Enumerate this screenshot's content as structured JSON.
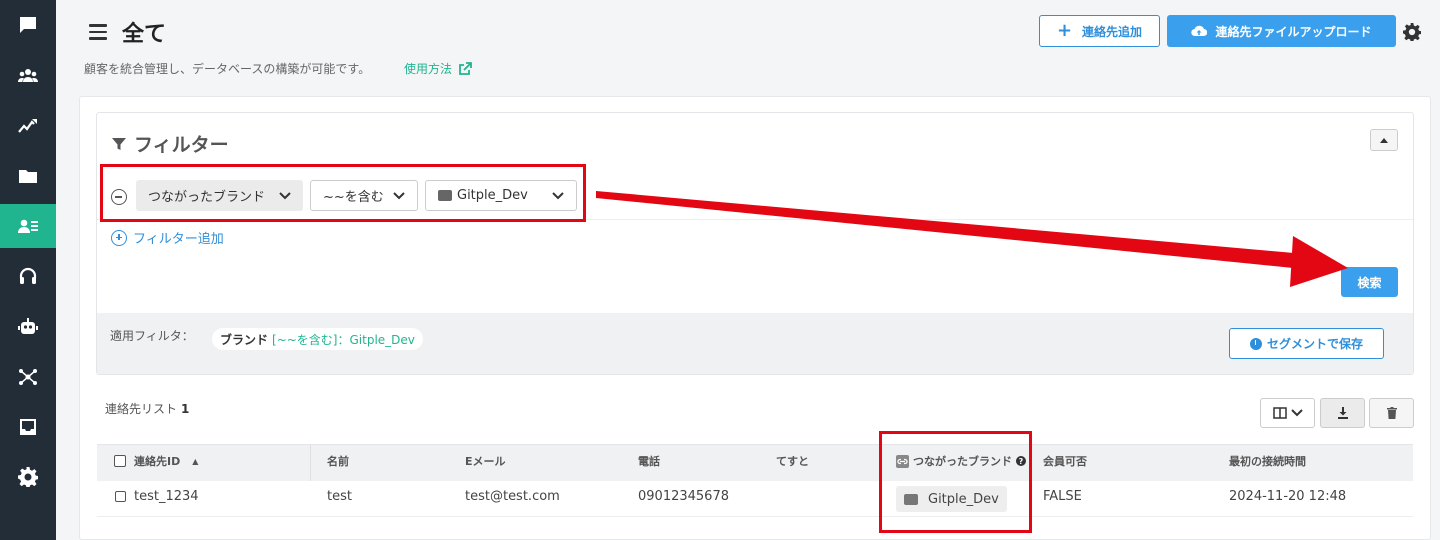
{
  "sidebar": {
    "items": [
      {
        "icon": "chat-icon"
      },
      {
        "icon": "users-icon"
      },
      {
        "icon": "analytics-icon"
      },
      {
        "icon": "folder-icon"
      },
      {
        "icon": "contacts-icon",
        "active": true
      },
      {
        "icon": "headset-icon"
      },
      {
        "icon": "bot-icon"
      },
      {
        "icon": "network-icon"
      },
      {
        "icon": "inbox-icon"
      },
      {
        "icon": "settings-icon"
      }
    ],
    "bg_color": "#222d38",
    "active_color": "#20b58f"
  },
  "header": {
    "title": "全て",
    "description": "顧客を統合管理し、データベースの構築が可能です。",
    "help_link": "使用方法",
    "add_contact_label": "連絡先追加",
    "upload_label": "連絡先ファイルアップロード"
  },
  "filter": {
    "title": "フィルター",
    "field_select": "つながったブランド",
    "operator_select": "~~を含む",
    "value_select": "Gitple_Dev",
    "add_filter_label": "フィルター追加",
    "search_label": "検索",
    "applied_label": "適用フィルタ：",
    "applied_key": "ブランド",
    "applied_value": "[~~を含む]：Gitple_Dev",
    "save_segment_label": "セグメントで保存"
  },
  "list": {
    "label": "連絡先リスト",
    "count": "1",
    "columns": [
      "連絡先ID",
      "名前",
      "Eメール",
      "電話",
      "てすと",
      "つながったブランド",
      "会員可否",
      "最初の接続時間"
    ],
    "rows": [
      {
        "id": "test_1234",
        "name": "test",
        "email": "test@test.com",
        "phone": "09012345678",
        "test": "",
        "brand": "Gitple_Dev",
        "member": "FALSE",
        "first_connect": "2024-11-20 12:48"
      }
    ]
  },
  "colors": {
    "primary": "#3aa0ee",
    "link": "#2f8fdb",
    "accent": "#20b58f",
    "annotation": "#e30613"
  }
}
